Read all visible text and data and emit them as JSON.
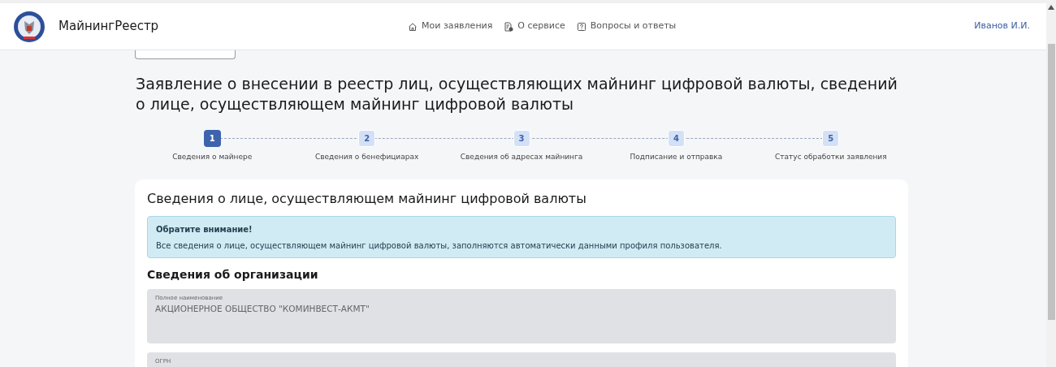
{
  "header": {
    "brand": "МайнингРеестр",
    "nav": [
      {
        "label": "Мои заявления"
      },
      {
        "label": "О сервисе"
      },
      {
        "label": "Вопросы и ответы"
      }
    ],
    "user": "Иванов И.И."
  },
  "page_title": "Заявление о внесении в реестр лиц, осуществляющих майнинг цифровой валюты, сведений о лице, осуществляющем майнинг цифровой валюты",
  "steps": [
    {
      "number": "1",
      "label": "Сведения о майнере",
      "selected": true
    },
    {
      "number": "2",
      "label": "Сведения о бенефициарах",
      "selected": false
    },
    {
      "number": "3",
      "label": "Сведения об адресах майнинга",
      "selected": false
    },
    {
      "number": "4",
      "label": "Подписание и отправка",
      "selected": false
    },
    {
      "number": "5",
      "label": "Статус обработки заявления",
      "selected": false
    }
  ],
  "card": {
    "title": "Сведения о лице, осуществляющем майнинг цифровой валюты",
    "alert": {
      "title": "Обратите внимание!",
      "text": "Все сведения о лице, осуществляющем майнинг цифровой валюты, заполняются автоматически данными профиля пользователя."
    },
    "section": "Сведения об организации",
    "fields": [
      {
        "label": "Полное наименование",
        "value": "АКЦИОНЕРНОЕ ОБЩЕСТВО \"КОМИНВЕСТ-АКМТ\"",
        "disabled": true
      },
      {
        "label": "ОГРН",
        "disabled": true
      }
    ]
  }
}
